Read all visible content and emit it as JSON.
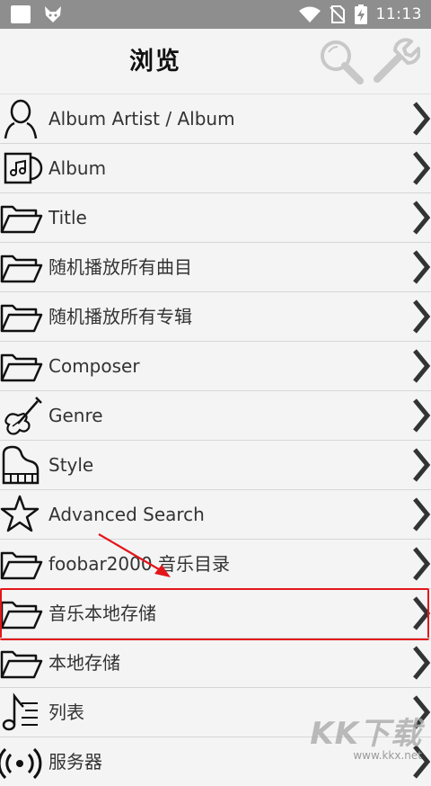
{
  "status_bar": {
    "time": "11:13"
  },
  "header": {
    "title": "浏览"
  },
  "items": [
    {
      "label": "Album Artist / Album",
      "icon": "person-icon"
    },
    {
      "label": "Album",
      "icon": "album-icon"
    },
    {
      "label": "Title",
      "icon": "folder-icon"
    },
    {
      "label": "随机播放所有曲目",
      "icon": "folder-icon"
    },
    {
      "label": "随机播放所有专辑",
      "icon": "folder-icon"
    },
    {
      "label": "Composer",
      "icon": "folder-icon"
    },
    {
      "label": "Genre",
      "icon": "violin-icon"
    },
    {
      "label": "Style",
      "icon": "piano-icon"
    },
    {
      "label": "Advanced Search",
      "icon": "star-icon"
    },
    {
      "label": "foobar2000 音乐目录",
      "icon": "folder-icon"
    },
    {
      "label": "音乐本地存储",
      "icon": "folder-icon"
    },
    {
      "label": "本地存储",
      "icon": "folder-icon"
    },
    {
      "label": "列表",
      "icon": "playlist-icon"
    },
    {
      "label": "服务器",
      "icon": "broadcast-icon"
    }
  ],
  "highlight_color": "#e3161b",
  "watermark": {
    "text": "KK下载",
    "url": "www.kkx.net"
  }
}
